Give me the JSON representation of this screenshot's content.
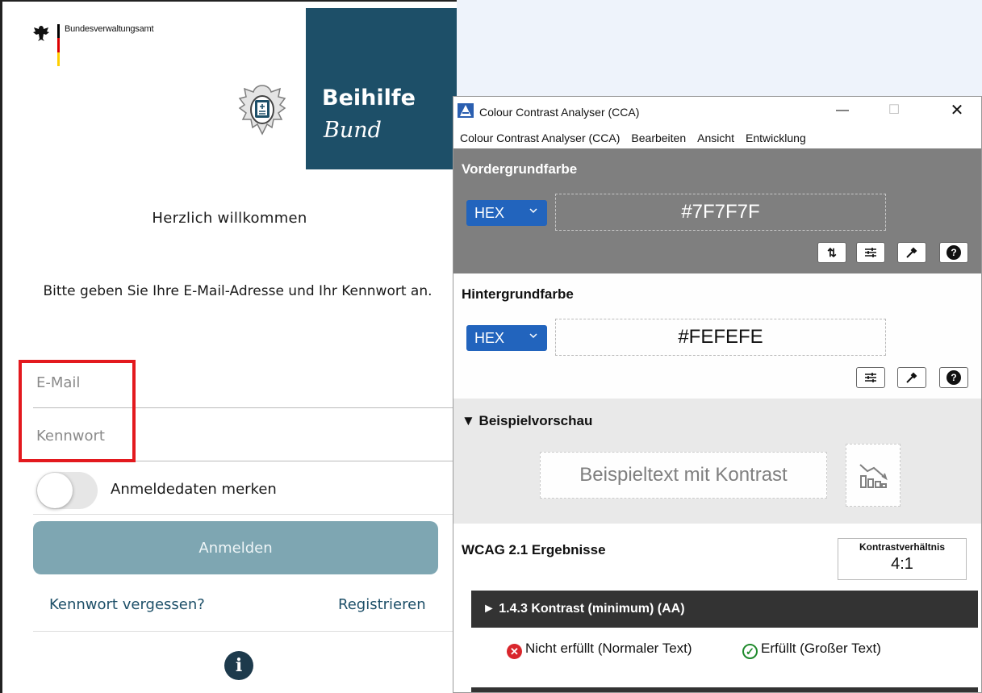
{
  "app": {
    "agency_name": "Bundesverwaltungsamt",
    "brand_line1": "Beihilfe",
    "brand_line2": "Bund",
    "welcome": "Herzlich willkommen",
    "instructions": "Bitte geben Sie Ihre E-Mail-Adresse und Ihr Kennwort an.",
    "email_placeholder": "E-Mail",
    "password_placeholder": "Kennwort",
    "remember_label": "Anmeldedaten merken",
    "remember_checked": false,
    "login_button": "Anmelden",
    "forgot_link": "Kennwort vergessen?",
    "register_link": "Registrieren",
    "info_icon": "info-icon",
    "brand_color": "#1d4f68",
    "button_color": "#7ea6b2",
    "highlight_color": "#e3191e"
  },
  "cca": {
    "title": "Colour Contrast Analyser (CCA)",
    "menu": [
      "Colour Contrast Analyser (CCA)",
      "Bearbeiten",
      "Ansicht",
      "Entwicklung"
    ],
    "foreground": {
      "title": "Vordergrundfarbe",
      "format": "HEX",
      "value": "#7F7F7F",
      "tools": [
        "swap-icon",
        "sliders-icon",
        "eyedropper-icon",
        "help-icon"
      ]
    },
    "background": {
      "title": "Hintergrundfarbe",
      "format": "HEX",
      "value": "#FEFEFE",
      "tools": [
        "sliders-icon",
        "eyedropper-icon",
        "help-icon"
      ]
    },
    "preview": {
      "title": "▼ Beispielvorschau",
      "sample_text": "Beispieltext mit Kontrast"
    },
    "results": {
      "title": "WCAG 2.1 Ergebnisse",
      "ratio_label": "Kontrastverhältnis",
      "ratio_value": "4:1",
      "criterion": "► 1.4.3 Kontrast (minimum) (AA)",
      "normal_text_result": "Nicht erfüllt (Normaler Text)",
      "large_text_result": "Erfüllt (Großer Text)"
    }
  }
}
